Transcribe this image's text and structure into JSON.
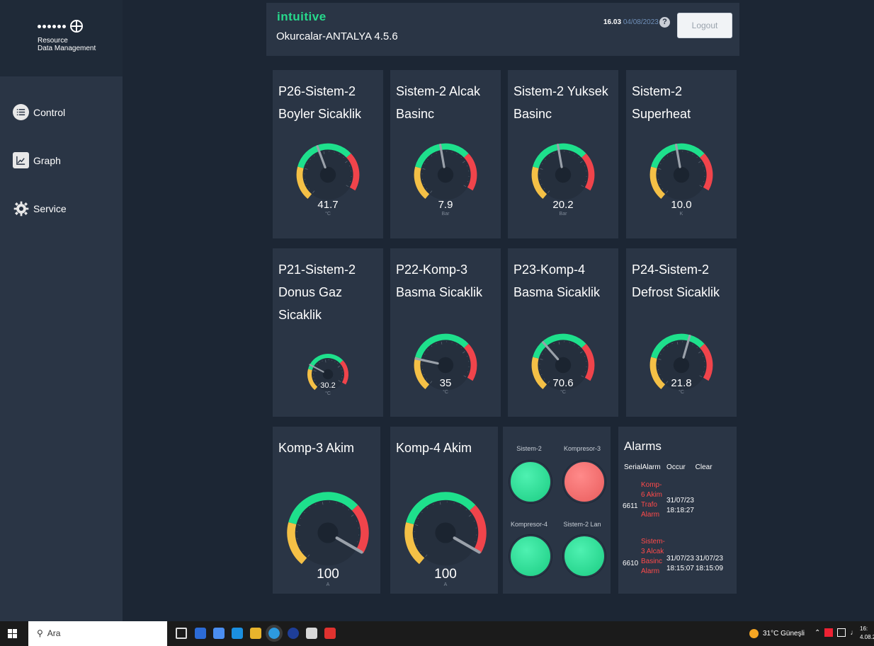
{
  "app": {
    "logo_line1": "Resource",
    "logo_line2": "Data Management",
    "brand": "intuitive",
    "site": "Okurcalar-ANTALYA 4.5.6",
    "time": "16.03",
    "date": "04/08/2023",
    "help": "?",
    "logout_label": "Logout"
  },
  "sidebar": {
    "items": [
      {
        "label": "Control",
        "icon": "list-icon"
      },
      {
        "label": "Graph",
        "icon": "chart-icon"
      },
      {
        "label": "Service",
        "icon": "gear-icon"
      }
    ]
  },
  "colors": {
    "green": "#1ee08c",
    "yellow": "#f4c046",
    "red": "#f0444b",
    "needle": "#9aa1aa",
    "card": "#2a3545",
    "background": "#1c2634"
  },
  "gauges": [
    {
      "title_l1": "P26-Sistem-2",
      "title_l2": "Boyler Sicaklik",
      "title_l3": "",
      "value": "41.7",
      "unit": "°C",
      "level": 0.46
    },
    {
      "title_l1": "Sistem-2 Alcak",
      "title_l2": "Basinc",
      "title_l3": "",
      "value": "7.9",
      "unit": "Bar",
      "level": 0.5
    },
    {
      "title_l1": "Sistem-2 Yuksek",
      "title_l2": "Basinc",
      "title_l3": "",
      "value": "20.2",
      "unit": "Bar",
      "level": 0.5
    },
    {
      "title_l1": "Sistem-2",
      "title_l2": "Superheat",
      "title_l3": "",
      "value": "10.0",
      "unit": "K",
      "level": 0.5
    },
    {
      "title_l1": "P21-Sistem-2",
      "title_l2": "Donus Gaz",
      "title_l3": "Sicaklik",
      "value": "30.2",
      "unit": "°C",
      "level": 0.3
    },
    {
      "title_l1": "P22-Komp-3",
      "title_l2": "Basma Sicaklik",
      "title_l3": "",
      "value": "35",
      "unit": "°C",
      "level": 0.24
    },
    {
      "title_l1": "P23-Komp-4",
      "title_l2": "Basma Sicaklik",
      "title_l3": "",
      "value": "70.6",
      "unit": "°C",
      "level": 0.38
    },
    {
      "title_l1": "P24-Sistem-2",
      "title_l2": "Defrost Sicaklik",
      "title_l3": "",
      "value": "21.8",
      "unit": "°C",
      "level": 0.6
    },
    {
      "title_l1": "Komp-3 Akim",
      "title_l2": "",
      "title_l3": "",
      "value": "100",
      "unit": "A",
      "level": 1.0
    },
    {
      "title_l1": "Komp-4 Akim",
      "title_l2": "",
      "title_l3": "",
      "value": "100",
      "unit": "A",
      "level": 1.0
    }
  ],
  "status_lights": [
    {
      "label": "Sistem-2",
      "state": "green"
    },
    {
      "label": "Kompresor-3",
      "state": "red"
    },
    {
      "label": "Kompresor-4",
      "state": "green"
    },
    {
      "label": "Sistem-2 Lan",
      "state": "green"
    }
  ],
  "alarms": {
    "title": "Alarms",
    "columns": [
      "Serial",
      "Alarm",
      "Occur",
      "Clear"
    ],
    "rows": [
      {
        "serial": "6611",
        "name": "Komp-6 Akim Trafo Alarm",
        "occur": "31/07/23 18:18:27",
        "clear": ""
      },
      {
        "serial": "6610",
        "name": "Sistem-3 Alcak Basinc Alarm",
        "occur": "31/07/23 18:15:07",
        "clear": "31/07/23 18:15:09"
      }
    ]
  },
  "taskbar": {
    "search_placeholder": "Ara",
    "weather": "31°C Güneşli",
    "clock_time": "16:",
    "clock_date": "4.08.2"
  }
}
